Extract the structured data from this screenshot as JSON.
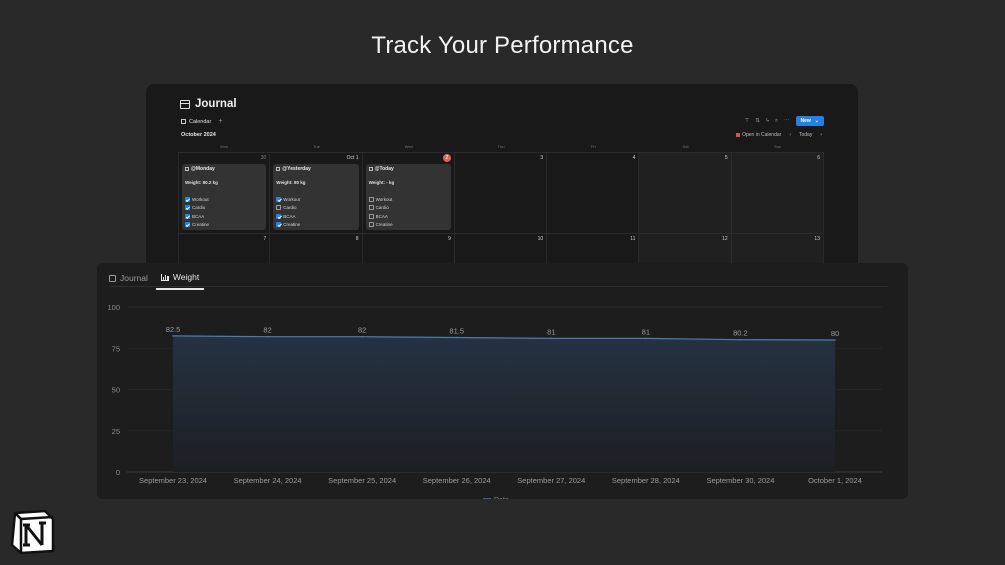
{
  "headline": "Track Your Performance",
  "journal": {
    "title": "Journal",
    "title_icon": "calendar-icon",
    "view_tab": "Calendar",
    "add_view": "+",
    "toolbar": {
      "icons": [
        "filter-icon",
        "sort-icon",
        "lightning-icon",
        "search-icon",
        "more-icon"
      ],
      "new_label": "New",
      "new_caret": "⌄"
    },
    "month_label": "October 2024",
    "open_in_calendar": "Open in Calendar",
    "today_label": "Today",
    "weekdays": [
      "Mon",
      "Tue",
      "Wed",
      "Thu",
      "Fri",
      "Sat",
      "Sun"
    ],
    "week1": [
      "30",
      "Oct 1",
      "2",
      "3",
      "4",
      "5",
      "6"
    ],
    "week2": [
      "7",
      "8",
      "9",
      "10",
      "11",
      "12",
      "13"
    ],
    "events": [
      {
        "title": "@Monday",
        "weight": "Weight: 80.2 kg",
        "checks": [
          {
            "label": "Workout",
            "checked": true
          },
          {
            "label": "Cardio",
            "checked": true
          },
          {
            "label": "BCAA",
            "checked": true
          },
          {
            "label": "Creatine",
            "checked": true
          }
        ]
      },
      {
        "title": "@Yesterday",
        "weight": "Weight: 80 kg",
        "checks": [
          {
            "label": "Workout",
            "checked": true
          },
          {
            "label": "Cardio",
            "checked": false
          },
          {
            "label": "BCAA",
            "checked": true
          },
          {
            "label": "Creatine",
            "checked": true
          }
        ]
      },
      {
        "title": "@Today",
        "weight": "Weight: - kg",
        "checks": [
          {
            "label": "Workout",
            "checked": false
          },
          {
            "label": "Cardio",
            "checked": false
          },
          {
            "label": "BCAA",
            "checked": false
          },
          {
            "label": "Creatine",
            "checked": false
          }
        ]
      }
    ]
  },
  "weight_view": {
    "tabs": [
      {
        "label": "Journal",
        "icon": "calendar-icon",
        "active": false
      },
      {
        "label": "Weight",
        "icon": "bar-chart-icon",
        "active": true
      }
    ]
  },
  "chart_data": {
    "type": "area",
    "categories": [
      "September 23, 2024",
      "September 24, 2024",
      "September 25, 2024",
      "September 26, 2024",
      "September 27, 2024",
      "September 28, 2024",
      "September 30, 2024",
      "October 1, 2024"
    ],
    "series": [
      {
        "name": "Date",
        "values": [
          82.5,
          82,
          82,
          81.5,
          81,
          81,
          80.2,
          80
        ]
      }
    ],
    "data_labels": [
      "82.5",
      "82",
      "82",
      "81.5",
      "81",
      "81",
      "80.2",
      "80"
    ],
    "yticks": [
      "0",
      "25",
      "50",
      "75",
      "100"
    ],
    "ylim": [
      0,
      100
    ],
    "title": "",
    "xlabel": "",
    "ylabel": "",
    "legend_position": "bottom",
    "grid": true,
    "colors": {
      "line": "#4b7bb0",
      "fill_top": "#253243",
      "fill_bottom": "#1d1f22"
    }
  }
}
